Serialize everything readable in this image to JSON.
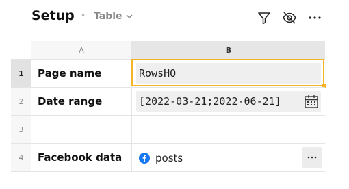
{
  "header": {
    "title": "Setup",
    "separator": "•",
    "view_label": "Table",
    "icons": [
      "filter-icon",
      "eye-off-icon",
      "more-horizontal-icon"
    ]
  },
  "grid": {
    "columns": [
      "A",
      "B"
    ],
    "rows": [
      {
        "num": "1",
        "label": "Page name",
        "value": "RowsHQ"
      },
      {
        "num": "2",
        "label": "Date range",
        "value": "[2022-03-21;2022-06-21]"
      },
      {
        "num": "3",
        "label": "",
        "value": ""
      },
      {
        "num": "4",
        "label": "Facebook data",
        "value": "posts"
      }
    ]
  },
  "colors": {
    "selection": "#f5b326",
    "facebook": "#1877f2"
  }
}
